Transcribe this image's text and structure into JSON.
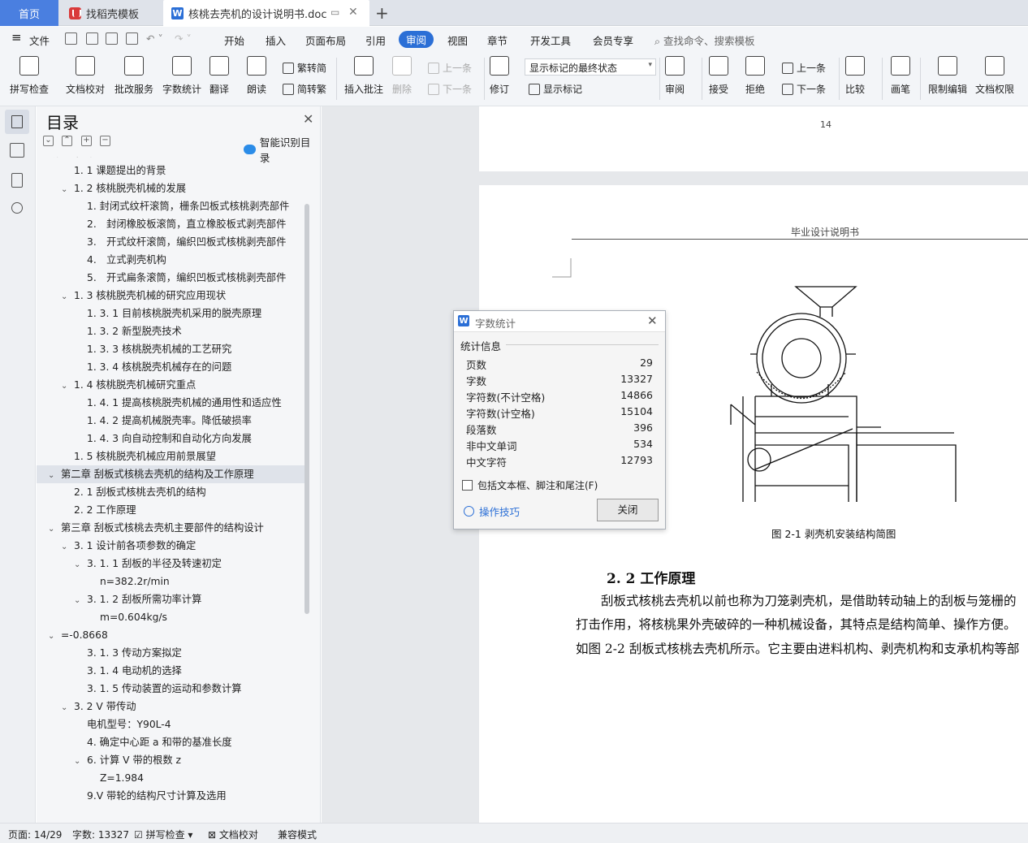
{
  "tabs": {
    "home": "首页",
    "templates": "找稻壳模板",
    "document": "核桃去壳机的设计说明书.doc"
  },
  "menu": {
    "file": "文件",
    "items": [
      "开始",
      "插入",
      "页面布局",
      "引用",
      "审阅",
      "视图",
      "章节",
      "开发工具",
      "会员专享"
    ],
    "active": "审阅",
    "search": "查找命令、搜索模板"
  },
  "ribbon": {
    "spellcheck": "拼写检查",
    "doc_proof": "文档校对",
    "batch_service": "批改服务",
    "word_count": "字数统计",
    "translate": "翻译",
    "read_aloud": "朗读",
    "to_traditional": "繁转简",
    "to_simplified": "简转繁",
    "insert_comment": "插入批注",
    "delete": "删除",
    "prev_comment": "上一条",
    "next_comment": "下一条",
    "revise": "修订",
    "markup_select": "显示标记的最终状态",
    "show_markup": "显示标记",
    "review": "审阅",
    "accept": "接受",
    "reject": "拒绝",
    "prev_change": "上一条",
    "next_change": "下一条",
    "compare": "比较",
    "pen": "画笔",
    "restrict_edit": "限制编辑",
    "doc_permission": "文档权限"
  },
  "toc": {
    "title": "目录",
    "smart": "智能识别目录",
    "items": [
      {
        "text": "1. 1 课题提出的背景",
        "indent": 1,
        "arrow": ""
      },
      {
        "text": "1. 2 核桃脱壳机械的发展",
        "indent": 1,
        "arrow": "v"
      },
      {
        "text": "1. 封闭式纹杆滚筒，栅条凹板式核桃剥壳部件",
        "indent": 2,
        "arrow": ""
      },
      {
        "text": "2.　封闭橡胶板滚筒，直立橡胶板式剥壳部件",
        "indent": 2,
        "arrow": ""
      },
      {
        "text": "3.　开式纹杆滚筒，编织凹板式核桃剥壳部件",
        "indent": 2,
        "arrow": ""
      },
      {
        "text": "4.　立式剥壳机构",
        "indent": 2,
        "arrow": ""
      },
      {
        "text": "5.　开式扁条滚筒，编织凹板式核桃剥壳部件",
        "indent": 2,
        "arrow": ""
      },
      {
        "text": "1. 3 核桃脱壳机械的研究应用现状",
        "indent": 1,
        "arrow": "v"
      },
      {
        "text": "1. 3. 1 目前核桃脱壳机采用的脱壳原理",
        "indent": 2,
        "arrow": ""
      },
      {
        "text": "1. 3. 2 新型脱壳技术",
        "indent": 2,
        "arrow": ""
      },
      {
        "text": "1. 3. 3 核桃脱壳机械的工艺研究",
        "indent": 2,
        "arrow": ""
      },
      {
        "text": "1. 3. 4 核桃脱壳机械存在的问题",
        "indent": 2,
        "arrow": ""
      },
      {
        "text": "1. 4 核桃脱壳机械研究重点",
        "indent": 1,
        "arrow": "v"
      },
      {
        "text": "1. 4. 1 提高核桃脱壳机械的通用性和适应性",
        "indent": 2,
        "arrow": ""
      },
      {
        "text": "1. 4. 2 提高机械脱壳率。降低破损率",
        "indent": 2,
        "arrow": ""
      },
      {
        "text": "1. 4. 3 向自动控制和自动化方向发展",
        "indent": 2,
        "arrow": ""
      },
      {
        "text": "1. 5 核桃脱壳机械应用前景展望",
        "indent": 1,
        "arrow": ""
      },
      {
        "text": "第二章 刮板式核桃去壳机的结构及工作原理",
        "indent": 0,
        "arrow": "v",
        "selected": true
      },
      {
        "text": "2. 1 刮板式核桃去壳机的结构",
        "indent": 1,
        "arrow": ""
      },
      {
        "text": "2. 2 工作原理",
        "indent": 1,
        "arrow": ""
      },
      {
        "text": "第三章 刮板式核桃去壳机主要部件的结构设计",
        "indent": 0,
        "arrow": "v"
      },
      {
        "text": "3. 1 设计前各项参数的确定",
        "indent": 1,
        "arrow": "v"
      },
      {
        "text": "3. 1. 1 刮板的半径及转速初定",
        "indent": 2,
        "arrow": "v"
      },
      {
        "text": "n=382.2r/min",
        "indent": 3,
        "arrow": ""
      },
      {
        "text": "3. 1. 2 刮板所需功率计算",
        "indent": 2,
        "arrow": "v"
      },
      {
        "text": "m=0.604kg/s",
        "indent": 3,
        "arrow": ""
      },
      {
        "text": "=-0.8668",
        "indent": 0,
        "arrow": "v"
      },
      {
        "text": "3. 1. 3 传动方案拟定",
        "indent": 2,
        "arrow": ""
      },
      {
        "text": "3. 1. 4 电动机的选择",
        "indent": 2,
        "arrow": ""
      },
      {
        "text": "3. 1. 5 传动装置的运动和参数计算",
        "indent": 2,
        "arrow": ""
      },
      {
        "text": "3. 2 V 带传动",
        "indent": 1,
        "arrow": "v"
      },
      {
        "text": "电机型号：Y90L-4",
        "indent": 2,
        "arrow": ""
      },
      {
        "text": "4. 确定中心距 a 和带的基准长度",
        "indent": 2,
        "arrow": ""
      },
      {
        "text": "6. 计算 V 带的根数 z",
        "indent": 2,
        "arrow": "v"
      },
      {
        "text": "Z=1.984",
        "indent": 3,
        "arrow": ""
      },
      {
        "text": "9.V 带轮的结构尺寸计算及选用",
        "indent": 2,
        "arrow": ""
      }
    ]
  },
  "document": {
    "page_number": "14",
    "header": "毕业设计说明书",
    "figure_caption": "图 2-1 剥壳机安装结构简图",
    "section_title": "2. 2  工作原理",
    "para1": "刮板式核桃去壳机以前也称为刀笼剥壳机，是借助转动轴上的刮板与笼栅的",
    "para2": "打击作用，将核桃果外壳破碎的一种机械设备，其特点是结构简单、操作方便。",
    "para3": "如图 2-2 刮板式核桃去壳机所示。它主要由进料机构、剥壳机构和支承机构等部"
  },
  "dialog": {
    "title": "字数统计",
    "section": "统计信息",
    "rows": [
      {
        "label": "页数",
        "value": "29"
      },
      {
        "label": "字数",
        "value": "13327"
      },
      {
        "label": "字符数(不计空格)",
        "value": "14866"
      },
      {
        "label": "字符数(计空格)",
        "value": "15104"
      },
      {
        "label": "段落数",
        "value": "396"
      },
      {
        "label": "非中文单词",
        "value": "534"
      },
      {
        "label": "中文字符",
        "value": "12793"
      }
    ],
    "checkbox": "包括文本框、脚注和尾注(F)",
    "tips": "操作技巧",
    "close": "关闭"
  },
  "status": {
    "page": "页面: 14/29",
    "words": "字数: 13327",
    "spell": "拼写检查",
    "proof": "文档校对",
    "compat": "兼容模式"
  }
}
